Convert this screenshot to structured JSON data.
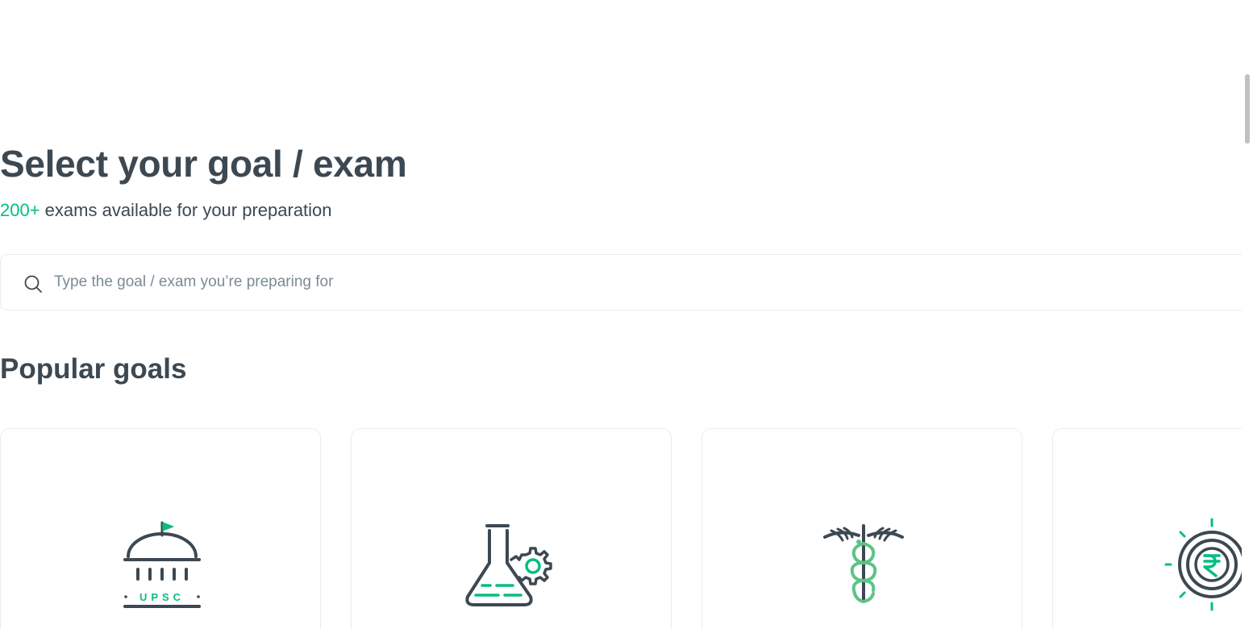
{
  "header": {
    "title": "Select your goal / exam",
    "subtitle_count": "200+",
    "subtitle_text": " exams available for your preparation"
  },
  "search": {
    "placeholder": "Type the goal / exam you’re preparing for",
    "value": ""
  },
  "popular": {
    "title": "Popular goals",
    "cards": [
      {
        "icon": "upsc-building-icon",
        "badge": "UPSC"
      },
      {
        "icon": "engineering-flask-gear-icon"
      },
      {
        "icon": "medical-caduceus-icon"
      },
      {
        "icon": "rupee-coin-icon"
      }
    ]
  },
  "colors": {
    "accent": "#08bd80",
    "text": "#3c4852",
    "muted": "#7a8b94",
    "border": "#e9eef2"
  }
}
